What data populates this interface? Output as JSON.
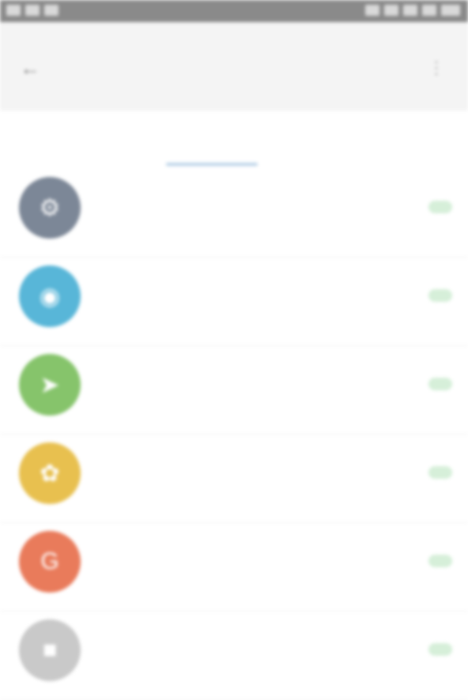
{
  "status_bar": {
    "left_items": [
      "",
      "",
      ""
    ],
    "right_items": [
      "",
      "",
      "",
      "",
      ""
    ]
  },
  "app_bar": {
    "back_icon": "arrow-left-icon",
    "title": "",
    "action_icon": "more-icon"
  },
  "tabs": [
    {
      "label": "",
      "active": false
    },
    {
      "label": "",
      "active": false
    },
    {
      "label": "",
      "active": true
    },
    {
      "label": "",
      "active": false
    },
    {
      "label": "",
      "active": false
    }
  ],
  "apps": [
    {
      "name": "",
      "subtitle": "",
      "meta": "",
      "icon": "settings-app-icon",
      "icon_color": "#7c8797"
    },
    {
      "name": "",
      "subtitle": "",
      "meta": "",
      "icon": "chrome-app-icon",
      "icon_color": "#58b6d8"
    },
    {
      "name": "",
      "subtitle": "",
      "meta": "",
      "icon": "maps-app-icon",
      "icon_color": "#86c46b"
    },
    {
      "name": "",
      "subtitle": "",
      "meta": "",
      "icon": "photos-app-icon",
      "icon_color": "#e8c04f"
    },
    {
      "name": "",
      "subtitle": "",
      "meta": "",
      "icon": "google-app-icon",
      "icon_color": "#e97b5b"
    },
    {
      "name": "",
      "subtitle": "",
      "meta": "",
      "icon": "app-icon",
      "icon_color": "#c9c9c9"
    }
  ],
  "colors": {
    "status_bar": "#8a8a8a",
    "app_bar": "#f4f4f4",
    "tab_indicator": "#b9d2e8",
    "action_pill": "#d6efd9"
  }
}
